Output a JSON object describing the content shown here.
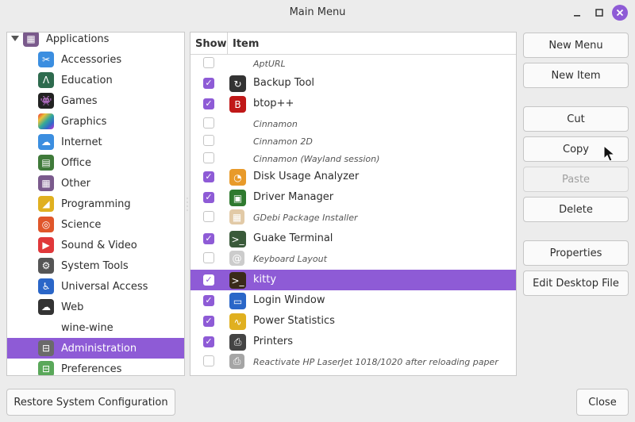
{
  "window": {
    "title": "Main Menu"
  },
  "colors": {
    "accent": "#8e5bd6"
  },
  "tree": {
    "root": {
      "label": "Applications",
      "icon": "grid-icon",
      "color": "#7a5a8c"
    },
    "items": [
      {
        "label": "Accessories",
        "icon": "scissors-icon",
        "color": "#3b8ee0"
      },
      {
        "label": "Education",
        "icon": "compass-icon",
        "color": "#2e6b4e"
      },
      {
        "label": "Games",
        "icon": "invader-icon",
        "color": "#222222"
      },
      {
        "label": "Graphics",
        "icon": "palette-icon",
        "color": "#c3399a"
      },
      {
        "label": "Internet",
        "icon": "cloud-icon",
        "color": "#3b8ee0"
      },
      {
        "label": "Office",
        "icon": "document-icon",
        "color": "#3f7a3a"
      },
      {
        "label": "Other",
        "icon": "grid-icon",
        "color": "#7a5a8c"
      },
      {
        "label": "Programming",
        "icon": "ruler-icon",
        "color": "#e0b020"
      },
      {
        "label": "Science",
        "icon": "atom-icon",
        "color": "#e0562a"
      },
      {
        "label": "Sound & Video",
        "icon": "play-icon",
        "color": "#e0383a"
      },
      {
        "label": "System Tools",
        "icon": "gear-icon",
        "color": "#555555"
      },
      {
        "label": "Universal Access",
        "icon": "accessibility-icon",
        "color": "#2a66c8"
      },
      {
        "label": "Web",
        "icon": "globe-cloud-icon",
        "color": "#333333"
      },
      {
        "label": "wine-wine",
        "icon": "",
        "color": ""
      },
      {
        "label": "Administration",
        "icon": "toggle-icon",
        "color": "#6a6a6a"
      },
      {
        "label": "Preferences",
        "icon": "toggle-icon",
        "color": "#5aa85a"
      }
    ]
  },
  "list": {
    "headers": {
      "show": "Show",
      "item": "Item"
    },
    "rows": [
      {
        "label": "AptURL",
        "checked": false,
        "hidden": true,
        "icon": "",
        "color": ""
      },
      {
        "label": "Backup Tool",
        "checked": true,
        "hidden": false,
        "icon": "backup-icon",
        "color": "#333333"
      },
      {
        "label": "btop++",
        "checked": true,
        "hidden": false,
        "icon": "btop-icon",
        "color": "#c01818"
      },
      {
        "label": "Cinnamon",
        "checked": false,
        "hidden": true,
        "icon": "",
        "color": ""
      },
      {
        "label": "Cinnamon 2D",
        "checked": false,
        "hidden": true,
        "icon": "",
        "color": ""
      },
      {
        "label": "Cinnamon (Wayland session)",
        "checked": false,
        "hidden": true,
        "icon": "",
        "color": ""
      },
      {
        "label": "Disk Usage Analyzer",
        "checked": true,
        "hidden": false,
        "icon": "pie-chart-icon",
        "color": "#e89a2a"
      },
      {
        "label": "Driver Manager",
        "checked": true,
        "hidden": false,
        "icon": "chip-icon",
        "color": "#2f7a2f"
      },
      {
        "label": "GDebi Package Installer",
        "checked": false,
        "hidden": true,
        "icon": "package-icon",
        "color": "#d9b98a"
      },
      {
        "label": "Guake Terminal",
        "checked": true,
        "hidden": false,
        "icon": "terminal-icon",
        "color": "#3a5a3a"
      },
      {
        "label": "Keyboard Layout",
        "checked": false,
        "hidden": true,
        "icon": "keyboard-icon",
        "color": "#bbbbbb"
      },
      {
        "label": "kitty",
        "checked": true,
        "hidden": false,
        "icon": "cat-terminal-icon",
        "color": "#3a2a1a",
        "selected": true
      },
      {
        "label": "Login Window",
        "checked": true,
        "hidden": false,
        "icon": "login-icon",
        "color": "#2a66c8"
      },
      {
        "label": "Power Statistics",
        "checked": true,
        "hidden": false,
        "icon": "graph-icon",
        "color": "#e0b020"
      },
      {
        "label": "Printers",
        "checked": true,
        "hidden": false,
        "icon": "printer-icon",
        "color": "#444444"
      },
      {
        "label": "Reactivate HP LaserJet 1018/1020 after reloading paper",
        "checked": false,
        "hidden": true,
        "icon": "printer-icon",
        "color": "#888888"
      }
    ]
  },
  "buttons": {
    "new_menu": "New Menu",
    "new_item": "New Item",
    "cut": "Cut",
    "copy": "Copy",
    "paste": "Paste",
    "delete": "Delete",
    "properties": "Properties",
    "edit_desktop": "Edit Desktop File",
    "restore": "Restore System Configuration",
    "close": "Close"
  }
}
